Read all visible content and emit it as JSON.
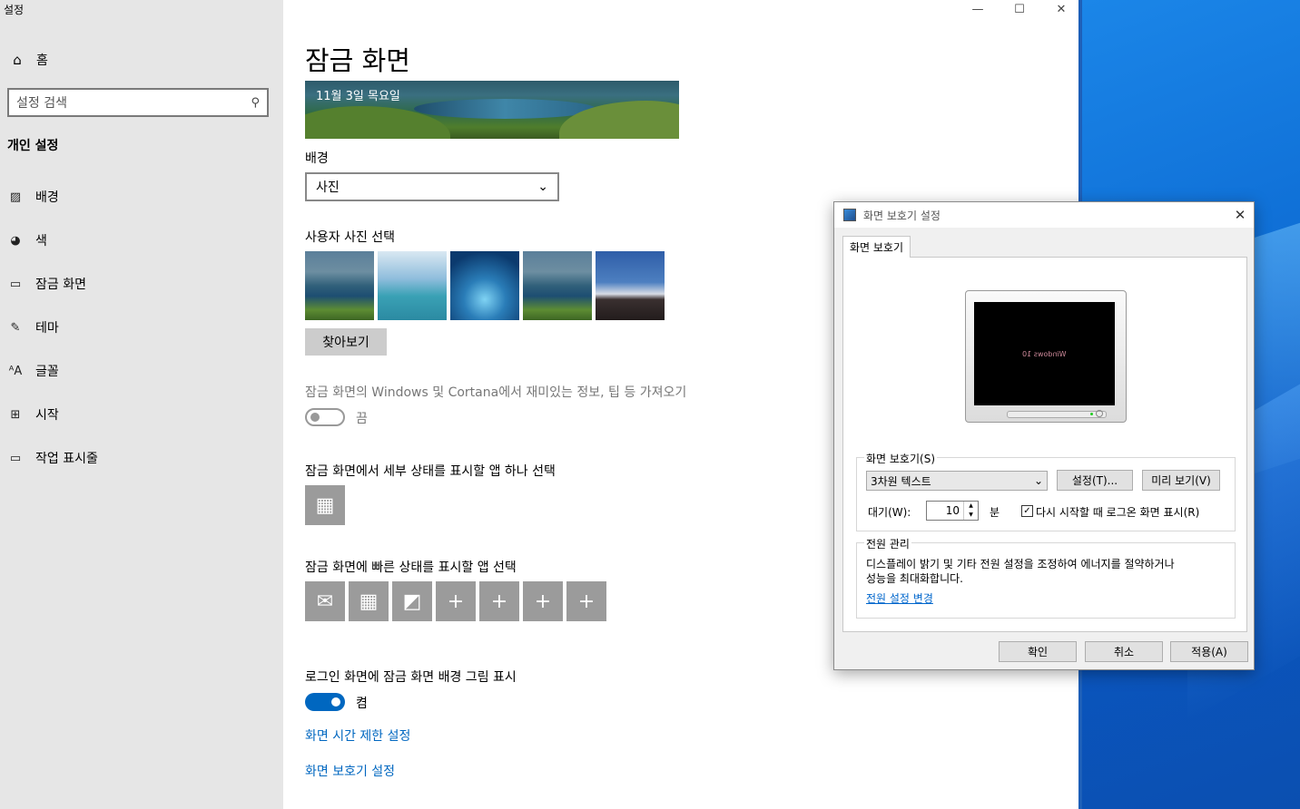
{
  "settings": {
    "window_title": "설정",
    "caption": {
      "minimize": "—",
      "maximize": "☐",
      "close": "✕"
    },
    "sidebar": {
      "home": {
        "icon": "home-icon",
        "label": "홈"
      },
      "search_placeholder": "설정 검색",
      "section": "개인 설정",
      "items": [
        {
          "icon": "picture-icon",
          "label": "배경"
        },
        {
          "icon": "palette-icon",
          "label": "색"
        },
        {
          "icon": "lock-screen-icon",
          "label": "잠금 화면"
        },
        {
          "icon": "theme-icon",
          "label": "테마"
        },
        {
          "icon": "font-icon",
          "label": "글꼴"
        },
        {
          "icon": "start-icon",
          "label": "시작"
        },
        {
          "icon": "taskbar-icon",
          "label": "작업 표시줄"
        }
      ]
    },
    "main": {
      "title": "잠금 화면",
      "preview_date": "11월 3일 목요일",
      "background_label": "배경",
      "background_value": "사진",
      "choose_photo_label": "사용자 사진 선택",
      "browse_button": "찾아보기",
      "fun_facts_label": "잠금 화면의 Windows 및 Cortana에서 재미있는 정보, 팁 등 가져오기",
      "fun_facts_state": "끔",
      "detailed_status_label": "잠금 화면에서 세부 상태를 표시할 앱 하나 선택",
      "quick_status_label": "잠금 화면에 빠른 상태를 표시할 앱 선택",
      "signin_bg_label": "로그인 화면에 잠금 화면 배경 그림 표시",
      "signin_bg_state": "켬",
      "screen_timeout_link": "화면 시간 제한 설정",
      "screensaver_link": "화면 보호기 설정"
    }
  },
  "dialog": {
    "title": "화면 보호기 설정",
    "tab": "화면 보호기",
    "preview_text": "Windows 10",
    "screensaver_group": "화면 보호기(S)",
    "screensaver_value": "3차원 텍스트",
    "settings_button": "설정(T)...",
    "preview_button": "미리 보기(V)",
    "wait_label": "대기(W):",
    "wait_value": "10",
    "wait_unit": "분",
    "resume_label": "다시 시작할 때 로그온 화면 표시(R)",
    "resume_checked": true,
    "power_group": "전원 관리",
    "power_text_1": "디스플레이 밝기 및 기타 전원 설정을 조정하여 에너지를 절약하거나",
    "power_text_2": "성능을 최대화합니다.",
    "power_link": "전원 설정 변경",
    "ok": "확인",
    "cancel": "취소",
    "apply": "적용(A)"
  }
}
